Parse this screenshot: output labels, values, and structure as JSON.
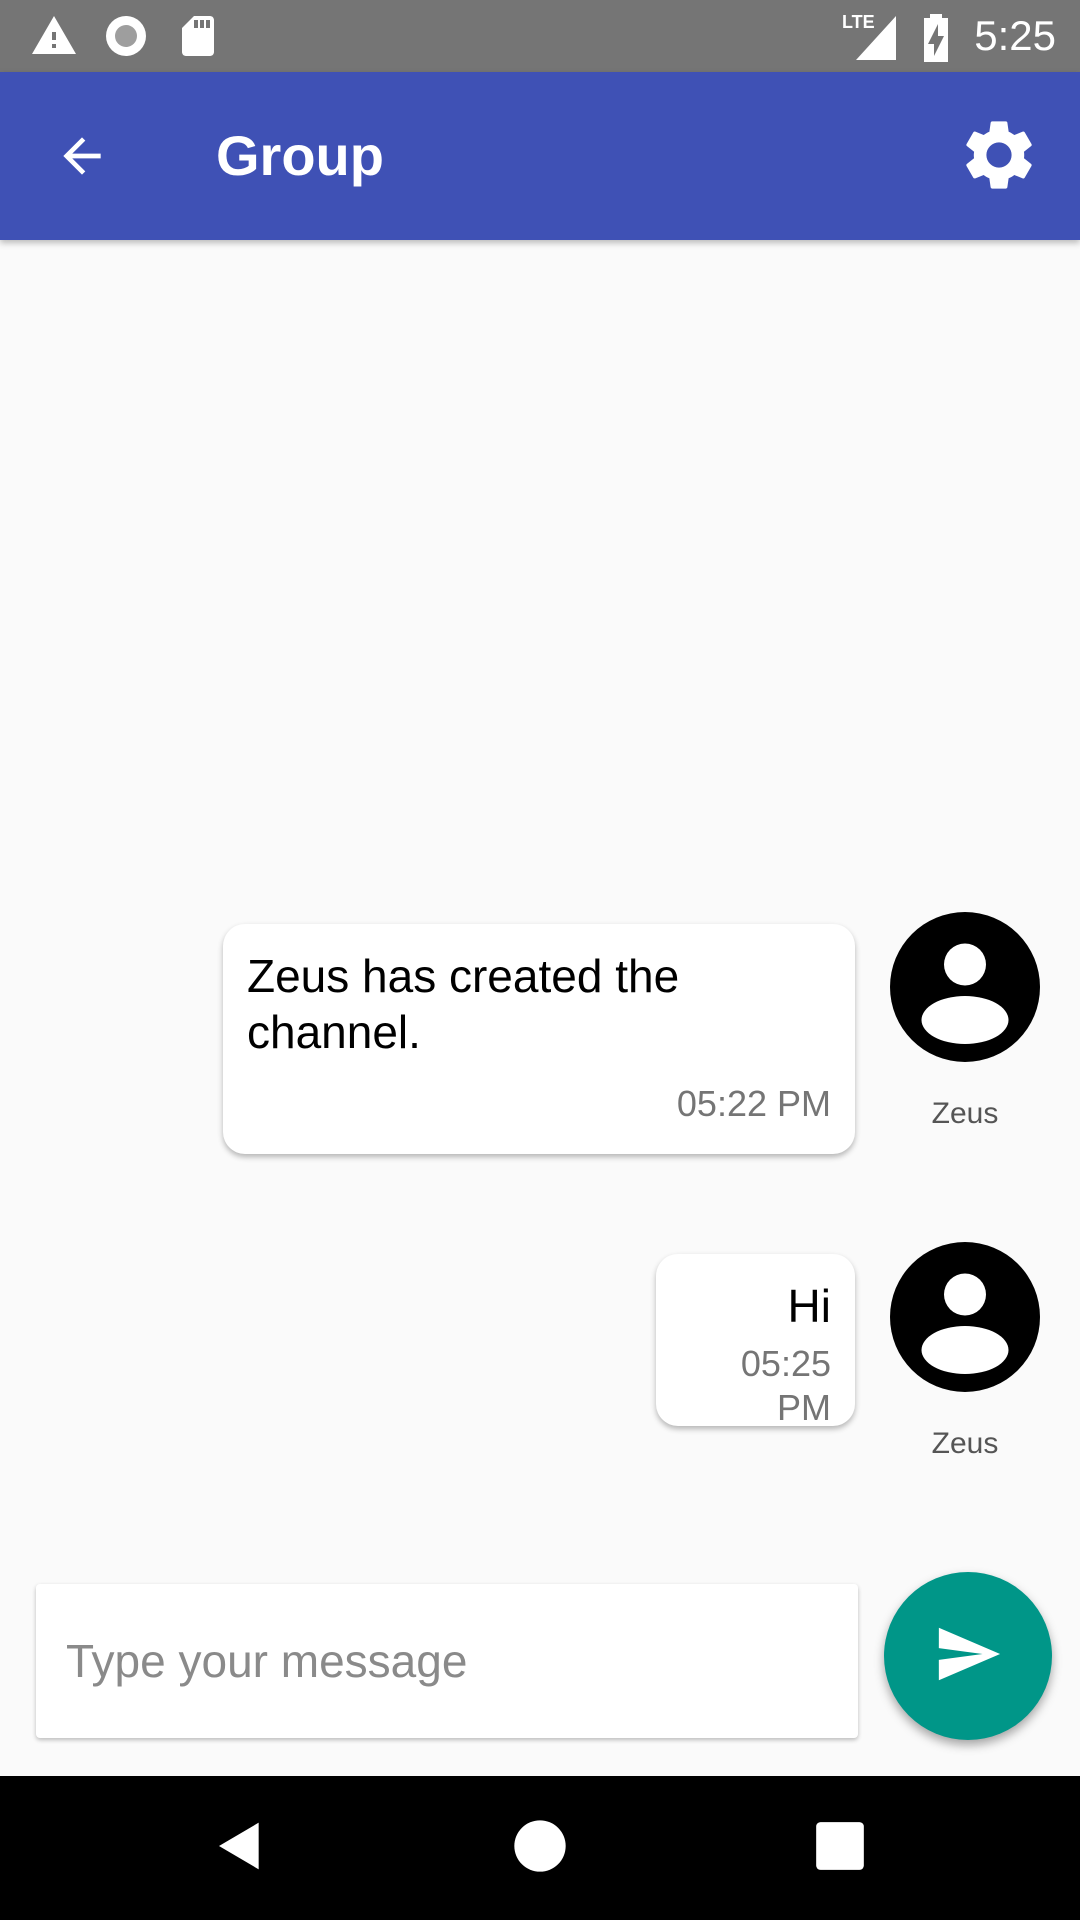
{
  "status_bar": {
    "time": "5:25",
    "network_label": "LTE",
    "icons": [
      "warning-icon",
      "circle-record-icon",
      "sd-card-icon",
      "signal-icon",
      "battery-charging-icon"
    ]
  },
  "app_bar": {
    "title": "Group",
    "back_icon": "arrow-back-icon",
    "settings_icon": "gear-icon",
    "color": "#3f51b5"
  },
  "messages": [
    {
      "text": "Zeus has created the channel.",
      "time": "05:22 PM",
      "sender": "Zeus",
      "avatar_icon": "account-circle-icon"
    },
    {
      "text": "Hi",
      "time": "05:25 PM",
      "sender": "Zeus",
      "avatar_icon": "account-circle-icon"
    }
  ],
  "composer": {
    "placeholder": "Type your message",
    "value": "",
    "send_icon": "send-icon",
    "send_color": "#009688"
  },
  "nav_bar": {
    "icons": [
      "nav-back-icon",
      "nav-home-icon",
      "nav-recents-icon"
    ]
  }
}
